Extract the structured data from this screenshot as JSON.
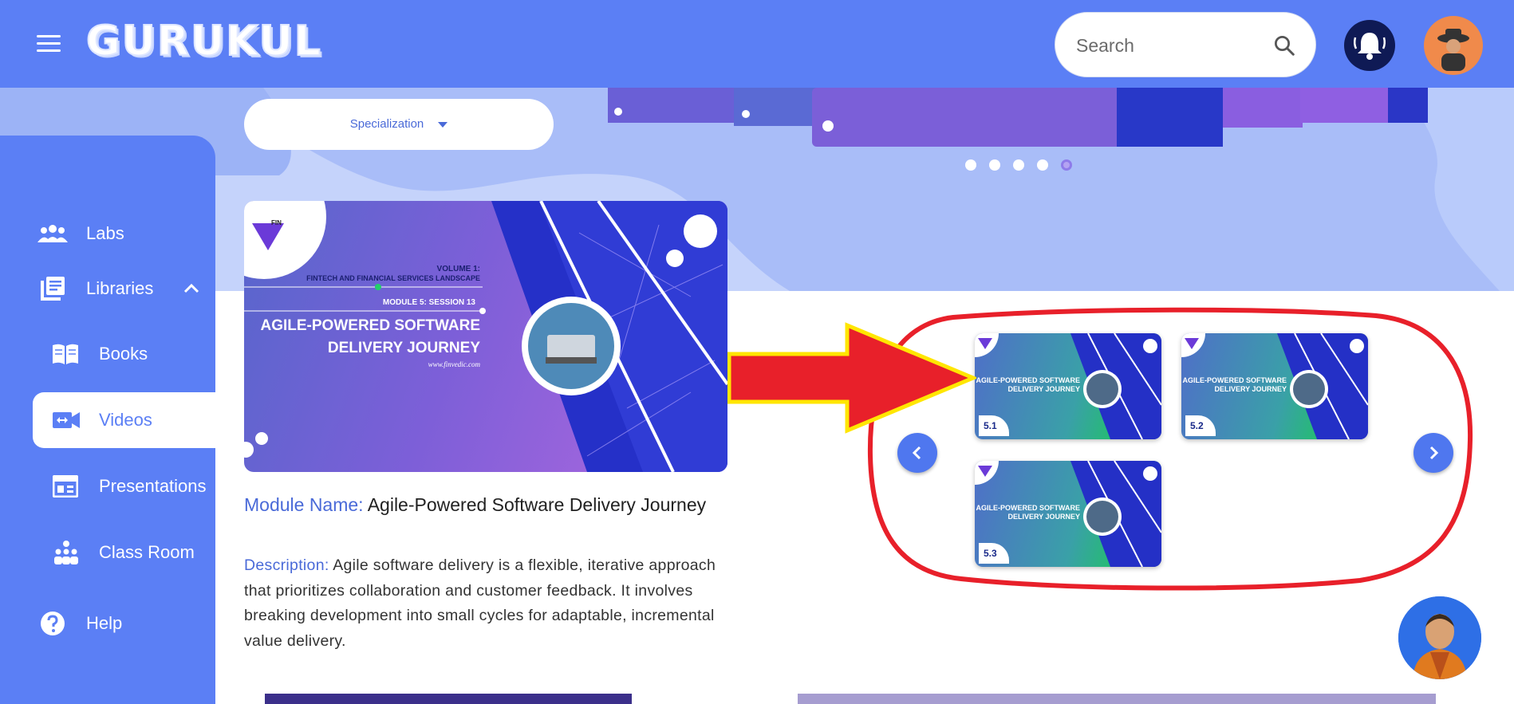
{
  "header": {
    "logo_text": "GURUKUL",
    "search_placeholder": "Search"
  },
  "specialization": {
    "label": "Specialization"
  },
  "carousel": {
    "dots": 5,
    "active_dot": 5
  },
  "sidebar": {
    "items": [
      {
        "label": "Labs",
        "icon": "people-group-icon"
      },
      {
        "label": "Libraries",
        "icon": "library-icon"
      },
      {
        "label": "Books",
        "icon": "book-icon"
      },
      {
        "label": "Videos",
        "icon": "video-camera-icon"
      },
      {
        "label": "Presentations",
        "icon": "presentation-icon"
      },
      {
        "label": "Class Room",
        "icon": "classroom-icon"
      },
      {
        "label": "Help",
        "icon": "help-circle-icon"
      }
    ]
  },
  "featured": {
    "brand": "FIN",
    "volume": "VOLUME 1:",
    "volume_title": "FINTECH AND FINANCIAL SERVICES LANDSCAPE",
    "session": "MODULE 5: SESSION 13",
    "title_line1": "AGILE-POWERED SOFTWARE",
    "title_line2": "DELIVERY JOURNEY",
    "website": "www.finvedic.com"
  },
  "module": {
    "name_label": "Module Name:",
    "name_value": "Agile-Powered Software Delivery Journey",
    "desc_label": "Description:",
    "desc_value": "Agile software delivery is a flexible, iterative approach that prioritizes collaboration and customer feedback. It involves breaking development into small cycles for adaptable, incremental value delivery."
  },
  "videos": [
    {
      "number": "5.1",
      "title_line1": "AGILE-POWERED SOFTWARE",
      "title_line2": "DELIVERY JOURNEY"
    },
    {
      "number": "5.2",
      "title_line1": "AGILE-POWERED SOFTWARE",
      "title_line2": "DELIVERY JOURNEY"
    },
    {
      "number": "5.3",
      "title_line1": "AGILE-POWERED SOFTWARE",
      "title_line2": "DELIVERY JOURNEY"
    }
  ],
  "colors": {
    "primary": "#5b7ff5",
    "annotation_red": "#e8202a",
    "annotation_yellow": "#ffe600"
  }
}
